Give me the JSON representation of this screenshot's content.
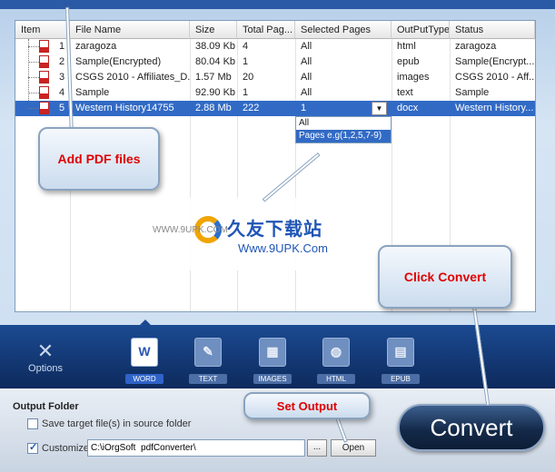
{
  "table": {
    "headers": [
      "Item",
      "File Name",
      "Size",
      "Total Pag...",
      "Selected Pages",
      "OutPutType",
      "Status"
    ],
    "rows": [
      {
        "num": "1",
        "name": "zaragoza",
        "size": "38.09 Kb",
        "pages": "4",
        "selected": "All",
        "type": "html",
        "status": "zaragoza"
      },
      {
        "num": "2",
        "name": "Sample(Encrypted)",
        "size": "80.04 Kb",
        "pages": "1",
        "selected": "All",
        "type": "epub",
        "status": "Sample(Encrypt..."
      },
      {
        "num": "3",
        "name": "CSGS 2010 - Affiliates_D...",
        "size": "1.57 Mb",
        "pages": "20",
        "selected": "All",
        "type": "images",
        "status": "CSGS 2010 - Aff..."
      },
      {
        "num": "4",
        "name": "Sample",
        "size": "92.90 Kb",
        "pages": "1",
        "selected": "All",
        "type": "text",
        "status": "Sample"
      },
      {
        "num": "5",
        "name": "Western History14755",
        "size": "2.88 Mb",
        "pages": "222",
        "selected": "1",
        "type": "docx",
        "status": "Western History..."
      }
    ],
    "dropdown_options": [
      "All",
      "Pages e.g(1,2,5,7-9)"
    ]
  },
  "callouts": {
    "add_pdf": "Add PDF files",
    "click_convert": "Click Convert",
    "set_output": "Set Output"
  },
  "watermark": {
    "cn": "久友下载站",
    "url": "Www.9UPK.Com",
    "side": "WWW.9UPK.COM"
  },
  "toolbar": {
    "options_label": "Options",
    "formats": [
      "WORD",
      "TEXT",
      "IMAGES",
      "HTML",
      "EPUB"
    ]
  },
  "output": {
    "section_title": "Output Folder",
    "save_in_source_label": "Save target file(s) in source folder",
    "save_in_source_checked": false,
    "customize_label": "Customize",
    "customize_checked": true,
    "path_value": "C:\\iOrgSoft  pdfConverter\\",
    "browse_label": "...",
    "open_label": "Open"
  },
  "convert_label": "Convert",
  "colors": {
    "selection": "#316ac5",
    "callout_text": "#e00000",
    "toolbar_bg": "#1b4a92"
  }
}
